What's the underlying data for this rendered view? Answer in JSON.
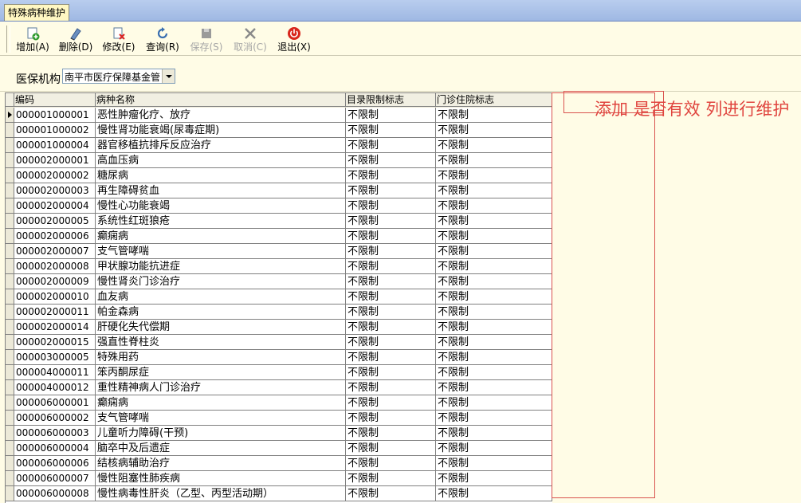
{
  "tab": {
    "title": "特殊病种维护"
  },
  "toolbar": {
    "add": "增加(A)",
    "delete": "删除(D)",
    "modify": "修改(E)",
    "query": "查询(R)",
    "save": "保存(S)",
    "cancel": "取消(C)",
    "exit": "退出(X)"
  },
  "filter": {
    "label": "医保机构",
    "value": "南平市医疗保障基金管"
  },
  "grid": {
    "columns": [
      "编码",
      "病种名称",
      "目录限制标志",
      "门诊住院标志"
    ],
    "rows": [
      [
        "000001000001",
        "恶性肿瘤化疗、放疗",
        "不限制",
        "不限制"
      ],
      [
        "000001000002",
        "慢性肾功能衰竭(尿毒症期)",
        "不限制",
        "不限制"
      ],
      [
        "000001000004",
        "器官移植抗排斥反应治疗",
        "不限制",
        "不限制"
      ],
      [
        "000002000001",
        "高血压病",
        "不限制",
        "不限制"
      ],
      [
        "000002000002",
        "糖尿病",
        "不限制",
        "不限制"
      ],
      [
        "000002000003",
        "再生障碍贫血",
        "不限制",
        "不限制"
      ],
      [
        "000002000004",
        "慢性心功能衰竭",
        "不限制",
        "不限制"
      ],
      [
        "000002000005",
        "系统性红斑狼疮",
        "不限制",
        "不限制"
      ],
      [
        "000002000006",
        "癫痫病",
        "不限制",
        "不限制"
      ],
      [
        "000002000007",
        "支气管哮喘",
        "不限制",
        "不限制"
      ],
      [
        "000002000008",
        "甲状腺功能抗进症",
        "不限制",
        "不限制"
      ],
      [
        "000002000009",
        "慢性肾炎门诊治疗",
        "不限制",
        "不限制"
      ],
      [
        "000002000010",
        "血友病",
        "不限制",
        "不限制"
      ],
      [
        "000002000011",
        "帕金森病",
        "不限制",
        "不限制"
      ],
      [
        "000002000014",
        "肝硬化失代偿期",
        "不限制",
        "不限制"
      ],
      [
        "000002000015",
        "强直性脊柱炎",
        "不限制",
        "不限制"
      ],
      [
        "000003000005",
        "特殊用药",
        "不限制",
        "不限制"
      ],
      [
        "000004000011",
        "笨丙酮尿症",
        "不限制",
        "不限制"
      ],
      [
        "000004000012",
        "重性精神病人门诊治疗",
        "不限制",
        "不限制"
      ],
      [
        "000006000001",
        "癫痫病",
        "不限制",
        "不限制"
      ],
      [
        "000006000002",
        "支气管哮喘",
        "不限制",
        "不限制"
      ],
      [
        "000006000003",
        "儿童听力障碍(干预)",
        "不限制",
        "不限制"
      ],
      [
        "000006000004",
        "脑卒中及后遗症",
        "不限制",
        "不限制"
      ],
      [
        "000006000006",
        "结核病辅助治疗",
        "不限制",
        "不限制"
      ],
      [
        "000006000007",
        "慢性阻塞性肺疾病",
        "不限制",
        "不限制"
      ],
      [
        "000006000008",
        "慢性病毒性肝炎（乙型、丙型活动期）",
        "不限制",
        "不限制"
      ]
    ]
  },
  "annotation": {
    "text": "添加 是否有效 列进行维护"
  },
  "colors": {
    "accent": "#e0443e",
    "background": "#fffce6"
  }
}
